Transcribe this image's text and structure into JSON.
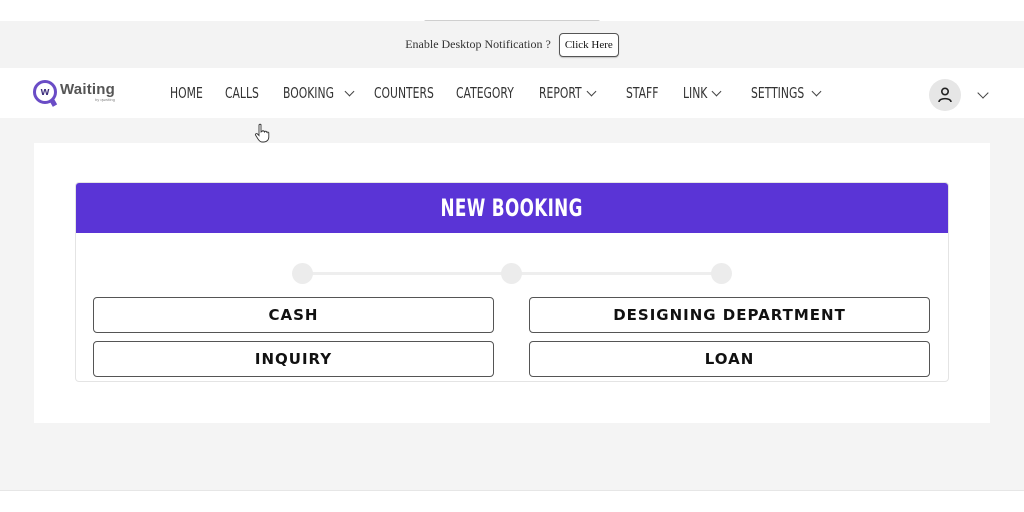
{
  "notification": {
    "text": "Enable Desktop Notification ?",
    "button_label": "Click Here"
  },
  "brand": {
    "logo_letter": "w",
    "name": "Waiting",
    "tagline": "by qwaiting"
  },
  "nav": {
    "items": [
      {
        "label": "HOME",
        "has_dropdown": false
      },
      {
        "label": "CALLS",
        "has_dropdown": false
      },
      {
        "label": "BOOKING",
        "has_dropdown": true
      },
      {
        "label": "COUNTERS",
        "has_dropdown": false
      },
      {
        "label": "CATEGORY",
        "has_dropdown": false
      },
      {
        "label": "REPORT",
        "has_dropdown": true
      },
      {
        "label": "STAFF",
        "has_dropdown": false
      },
      {
        "label": "LINK",
        "has_dropdown": true
      },
      {
        "label": "SETTINGS",
        "has_dropdown": true
      }
    ],
    "user_icon": "user-icon",
    "user_menu_icon": "chevron-down-icon"
  },
  "booking": {
    "title": "NEW BOOKING",
    "header_color": "#5a34d6",
    "steps_total": 3,
    "options": [
      {
        "label": "CASH"
      },
      {
        "label": "DESIGNING DEPARTMENT"
      },
      {
        "label": "INQUIRY"
      },
      {
        "label": "LOAN"
      }
    ]
  }
}
